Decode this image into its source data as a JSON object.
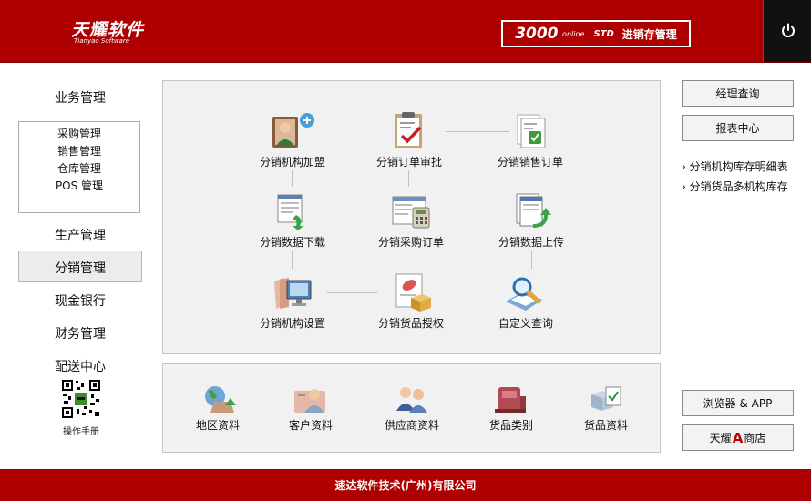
{
  "header": {
    "logo_cn": "天耀软件",
    "logo_en": "Tianyao Software",
    "product_num": "3000",
    "product_online": ".online",
    "product_std": "STD",
    "product_name": "进销存管理",
    "power_icon": "power-icon"
  },
  "nav": {
    "business": "业务管理",
    "sub_items": [
      "采购管理",
      "销售管理",
      "仓库管理",
      "POS 管理"
    ],
    "production": "生产管理",
    "distribution": "分销管理",
    "cash_bank": "现金银行",
    "finance": "财务管理",
    "delivery": "配送中心",
    "manual": "操作手册"
  },
  "main": {
    "modules": [
      {
        "label": "分销机构加盟",
        "icon": "org-join-icon"
      },
      {
        "label": "分销订单审批",
        "icon": "clipboard-check-icon"
      },
      {
        "label": "分销销售订单",
        "icon": "sales-order-icon"
      },
      {
        "label": "分销数据下载",
        "icon": "data-download-icon"
      },
      {
        "label": "分销采购订单",
        "icon": "purchase-order-icon"
      },
      {
        "label": "分销数据上传",
        "icon": "data-upload-icon"
      },
      {
        "label": "分销机构设置",
        "icon": "org-settings-icon"
      },
      {
        "label": "分销货品授权",
        "icon": "goods-auth-icon"
      },
      {
        "label": "自定义查询",
        "icon": "custom-query-icon"
      }
    ]
  },
  "bottom": {
    "items": [
      {
        "label": "地区资料",
        "icon": "region-icon"
      },
      {
        "label": "客户资料",
        "icon": "customer-icon"
      },
      {
        "label": "供应商资料",
        "icon": "supplier-icon"
      },
      {
        "label": "货品类别",
        "icon": "goods-category-icon"
      },
      {
        "label": "货品资料",
        "icon": "goods-data-icon"
      }
    ]
  },
  "right": {
    "manager_query": "经理查询",
    "report_center": "报表中心",
    "links": [
      "分销机构库存明细表",
      "分销货品多机构库存"
    ],
    "browser_app": "浏览器 & APP",
    "shop_prefix": "天耀",
    "shop_a": "A",
    "shop_suffix": "商店"
  },
  "footer": {
    "company": "速达软件技术(广州)有限公司"
  },
  "colors": {
    "brand_red": "#ae0000",
    "panel_bg": "#f1f1f1"
  }
}
